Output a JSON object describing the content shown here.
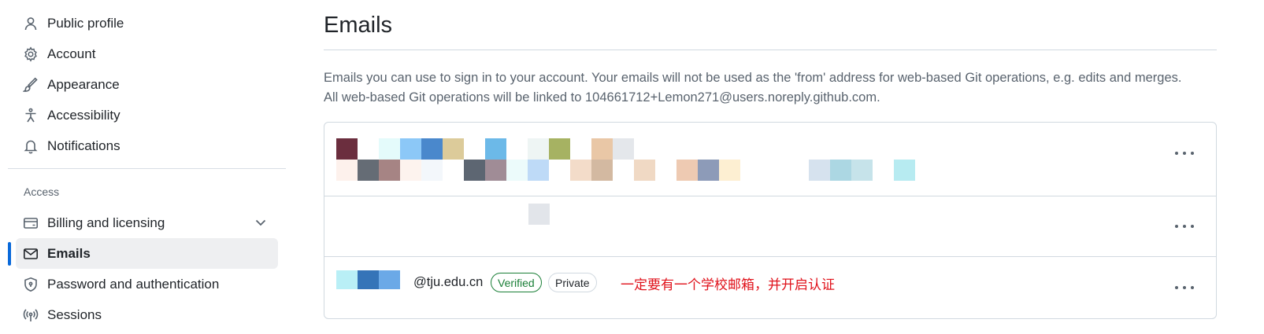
{
  "sidebar": {
    "items_top": [
      {
        "label": "Public profile",
        "icon": "person-icon"
      },
      {
        "label": "Account",
        "icon": "gear-icon"
      },
      {
        "label": "Appearance",
        "icon": "paintbrush-icon"
      },
      {
        "label": "Accessibility",
        "icon": "accessibility-icon"
      },
      {
        "label": "Notifications",
        "icon": "bell-icon"
      }
    ],
    "section_heading": "Access",
    "items_access": [
      {
        "label": "Billing and licensing",
        "icon": "credit-card-icon",
        "expandable": true
      },
      {
        "label": "Emails",
        "icon": "mail-icon",
        "active": true
      },
      {
        "label": "Password and authentication",
        "icon": "shield-lock-icon"
      },
      {
        "label": "Sessions",
        "icon": "broadcast-icon"
      }
    ]
  },
  "main": {
    "title": "Emails",
    "description_line1": "Emails you can use to sign in to your account. Your emails will not be used as the 'from' address for web-based Git operations, e.g. edits and merges.",
    "description_line2": "All web-based Git operations will be linked to 104661712+Lemon271@users.noreply.github.com.",
    "emails": [
      {
        "address_visible": "",
        "redacted": true
      },
      {
        "address_visible": "",
        "redacted": true
      },
      {
        "address_visible": "@tju.edu.cn",
        "redacted": true,
        "badges": [
          "Verified",
          "Private"
        ],
        "annotation": "一定要有一个学校邮箱，并开启认证"
      }
    ]
  },
  "colors": {
    "accent": "#0969da",
    "verified_green": "#1a7f37",
    "annotation_red": "#e0121b",
    "muted_text": "#59636e",
    "border": "#d1d9e0",
    "active_bg": "#eeeff1"
  }
}
